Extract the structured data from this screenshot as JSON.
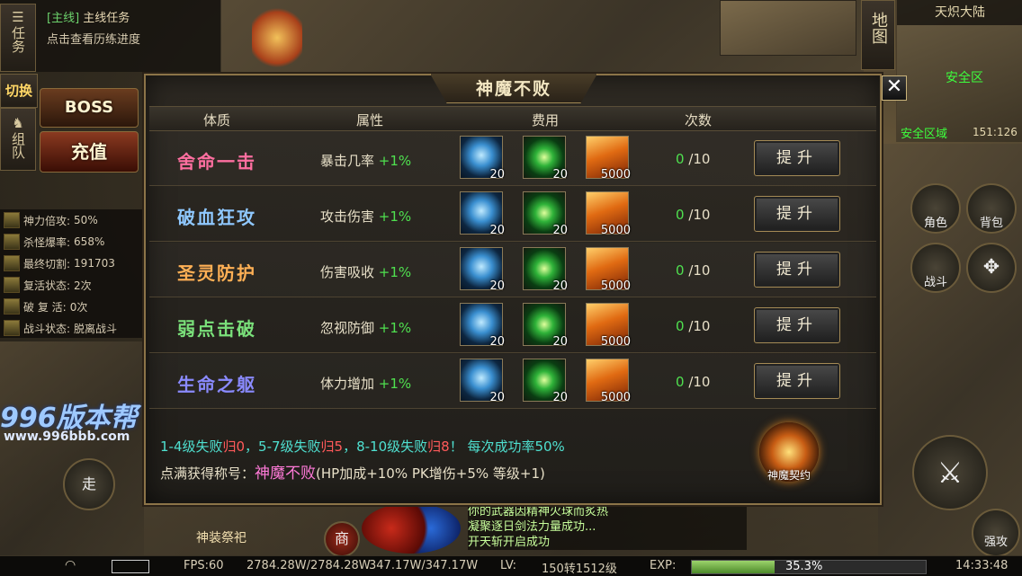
{
  "quest": {
    "tabs": [
      "任务",
      "切换",
      "组队"
    ],
    "title_tag": "[主线]",
    "title": "主线任务",
    "description": "点击查看历练进度",
    "boss_label": "BOSS",
    "recharge_label": "充值"
  },
  "stats": [
    {
      "label": "神力倍攻:",
      "value": "50%"
    },
    {
      "label": "杀怪爆率:",
      "value": "658%"
    },
    {
      "label": "最终切割:",
      "value": "191703"
    },
    {
      "label": "复活状态:",
      "value": "2次"
    },
    {
      "label": "破 复 活:",
      "value": "0次"
    },
    {
      "label": "战斗状态:",
      "value": "脱离战斗"
    }
  ],
  "dialog": {
    "title": "神魔不败",
    "close_label": "✕",
    "headers": [
      "体质",
      "属性",
      "费用",
      "次数"
    ],
    "rows": [
      {
        "name": "舍命一击",
        "name_color": "#ff6fa0",
        "attr": "暴击几率",
        "bonus": "+1%",
        "costs": [
          "20",
          "20",
          "5000"
        ],
        "current": "0",
        "max": "/10",
        "button": "提升"
      },
      {
        "name": "破血狂攻",
        "name_color": "#8fc8ff",
        "attr": "攻击伤害",
        "bonus": "+1%",
        "costs": [
          "20",
          "20",
          "5000"
        ],
        "current": "0",
        "max": "/10",
        "button": "提升"
      },
      {
        "name": "圣灵防护",
        "name_color": "#ffb055",
        "attr": "伤害吸收",
        "bonus": "+1%",
        "costs": [
          "20",
          "20",
          "5000"
        ],
        "current": "0",
        "max": "/10",
        "button": "提升"
      },
      {
        "name": "弱点击破",
        "name_color": "#7ae07a",
        "attr": "忽视防御",
        "bonus": "+1%",
        "costs": [
          "20",
          "20",
          "5000"
        ],
        "current": "0",
        "max": "/10",
        "button": "提升"
      },
      {
        "name": "生命之躯",
        "name_color": "#8a8aff",
        "attr": "体力增加",
        "bonus": "+1%",
        "costs": [
          "20",
          "20",
          "5000"
        ],
        "current": "0",
        "max": "/10",
        "button": "提升"
      }
    ],
    "footer1": {
      "a": "1-4级失败",
      "a_red": "归0",
      "b": "，5-7级失败",
      "b_red": "归5",
      "c": "，8-10级失败",
      "c_red": "归8",
      "d": "！ 每次成功率50%"
    },
    "footer2": {
      "prefix": "点满获得称号：",
      "title": "神魔不败",
      "suffix": "(HP加成+10% PK增伤+5% 等级+1)"
    },
    "contract_label": "神魔契约"
  },
  "right": {
    "map_label": "地图",
    "region": "天炽大陆",
    "safe_zone": "安全区",
    "safe_area": "安全区域",
    "coords": "151:126",
    "character_label": "角色",
    "bag_label": "背包",
    "battle_label": "战斗",
    "attack_label": "强攻"
  },
  "bottom": {
    "walk_label": "走",
    "shop_label": "商",
    "equip_sacrifice": "神装祭祀",
    "chat": [
      "你的武器因精神火球而炙热",
      "凝聚逐日剑法力量成功...",
      "开天斩开启成功"
    ],
    "fps": "FPS:60",
    "hp": "2784.28W/2784.28W",
    "mp": "347.17W/347.17W",
    "lv_label": "LV:",
    "lv": "150转1512级",
    "exp_label": "EXP:",
    "exp_percent": 35.3,
    "exp_text": "35.3%",
    "time": "14:33:48"
  },
  "watermark": {
    "logo": "996版本帮",
    "url": "www.996bbb.com"
  }
}
